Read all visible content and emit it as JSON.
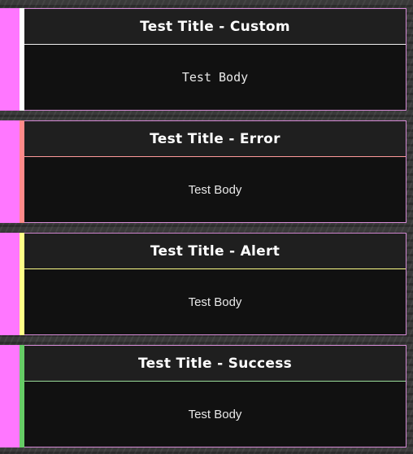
{
  "notifications": [
    {
      "title": "Test Title - Custom",
      "body": "Test Body",
      "type": "custom",
      "accent_color": "#ffffff",
      "divider_color": "#f0f0f0"
    },
    {
      "title": "Test Title - Error",
      "body": "Test Body",
      "type": "error",
      "accent_color": "#ff8a8a",
      "divider_color": "#ff9a9a"
    },
    {
      "title": "Test Title - Alert",
      "body": "Test Body",
      "type": "alert",
      "accent_color": "#ffff88",
      "divider_color": "#ffff88"
    },
    {
      "title": "Test Title - Success",
      "body": "Test Body",
      "type": "success",
      "accent_color": "#66cc66",
      "divider_color": "#99dd99"
    }
  ],
  "colors": {
    "side_strip": "#ff77ff",
    "card_border": "#d58ad5",
    "card_background": "#111111",
    "header_background": "#1f1f1f",
    "page_background": "#3a3a3a"
  }
}
